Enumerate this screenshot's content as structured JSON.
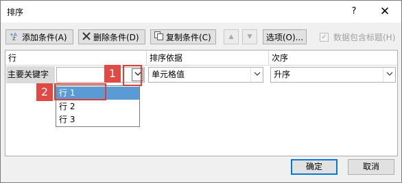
{
  "window": {
    "title": "排序",
    "help": "?",
    "close": "✕"
  },
  "toolbar": {
    "add_level": "添加条件(A)",
    "delete_level": "删除条件(D)",
    "copy_level": "复制条件(C)",
    "move_up": "▲",
    "move_down": "▼",
    "options": "选项(O)...",
    "header_checkbox_label": "数据包含标题(H)",
    "header_checkbox_checked": true
  },
  "grid": {
    "columns": [
      "行",
      "排序依据",
      "次序"
    ],
    "row_label": "主要关键字",
    "key_value": "",
    "sort_on_value": "单元格值",
    "order_value": "升序"
  },
  "dropdown": {
    "items": [
      "行 1",
      "行 2",
      "行 3"
    ],
    "selected_index": 0
  },
  "annotations": {
    "badge1": "1",
    "badge2": "2"
  },
  "buttons": {
    "ok": "确定",
    "cancel": "取消"
  },
  "colors": {
    "highlight": "#e03c31",
    "selection": "#5b9bd5",
    "badge": "#e04a45"
  }
}
